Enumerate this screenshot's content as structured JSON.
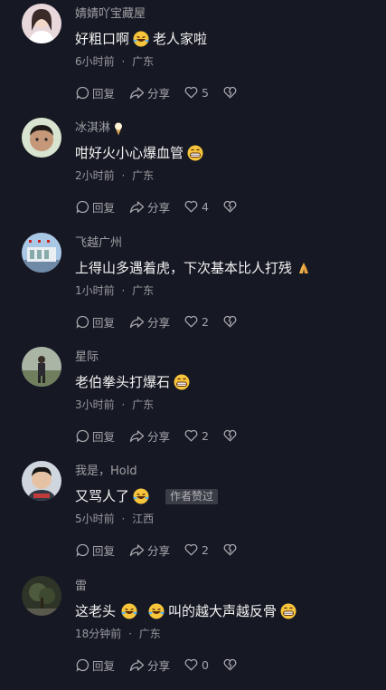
{
  "comments": [
    {
      "username": "婧婧吖宝藏屋",
      "text_parts": [
        "好粗口啊",
        "老人家啦"
      ],
      "emojis": [
        "laughing-tears-emoji"
      ],
      "time": "6小时前",
      "location": "广东",
      "reply_label": "回复",
      "share_label": "分享",
      "likes": "5"
    },
    {
      "username": "冰淇淋",
      "text_parts": [
        "咁好火小心爆血管"
      ],
      "emojis": [
        "ice-cream-emoji",
        "grimacing-emoji"
      ],
      "time": "2小时前",
      "location": "广东",
      "reply_label": "回复",
      "share_label": "分享",
      "likes": "4"
    },
    {
      "username": "飞越广州",
      "text_parts": [
        "上得山多遇着虎，下次基本比人打残"
      ],
      "emojis": [
        "praying-hands-emoji"
      ],
      "time": "1小时前",
      "location": "广东",
      "reply_label": "回复",
      "share_label": "分享",
      "likes": "2"
    },
    {
      "username": "星际",
      "text_parts": [
        "老伯拳头打爆石"
      ],
      "emojis": [
        "grimacing-emoji"
      ],
      "time": "3小时前",
      "location": "广东",
      "reply_label": "回复",
      "share_label": "分享",
      "likes": "2"
    },
    {
      "username": "我是，Hold",
      "text_parts": [
        "又骂人了"
      ],
      "emojis": [
        "laughing-tears-emoji"
      ],
      "author_badge": "作者赞过",
      "time": "5小时前",
      "location": "江西",
      "reply_label": "回复",
      "share_label": "分享",
      "likes": "2"
    },
    {
      "username": "雷",
      "text_parts": [
        "这老头",
        "叫的越大声越反骨"
      ],
      "emojis": [
        "laughing-tears-emoji",
        "laughing-tears-emoji",
        "grimacing-emoji"
      ],
      "time": "18分钟前",
      "location": "广东",
      "reply_label": "回复",
      "share_label": "分享",
      "likes": "0"
    }
  ],
  "meta_separator": "·",
  "colors": {
    "background": "#161823",
    "primary_text": "#f2f2f2",
    "secondary_text": "#8a8b91"
  }
}
